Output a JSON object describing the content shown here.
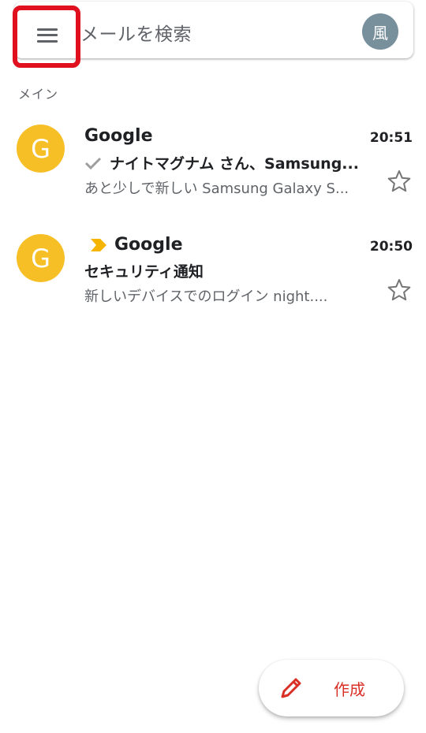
{
  "search": {
    "placeholder": "メールを検索",
    "account_initial": "風"
  },
  "section_label": "メイン",
  "emails": [
    {
      "avatar_letter": "G",
      "sender": "Google",
      "time": "20:51",
      "subject": "ナイトマグナム さん、Samsung...",
      "snippet": "あと少しで新しい Samsung Galaxy S...",
      "icon": "check-icon"
    },
    {
      "avatar_letter": "G",
      "sender": "Google",
      "time": "20:50",
      "subject": "セキュリティ通知",
      "snippet": "新しいデバイスでのログイン night....",
      "icon": "important-marker-icon"
    }
  ],
  "compose": {
    "label": "作成"
  },
  "colors": {
    "accent_red": "#d93025",
    "avatar_yellow": "#f6bf26",
    "highlight_red": "#e0101f",
    "important_yellow": "#f4b400"
  }
}
